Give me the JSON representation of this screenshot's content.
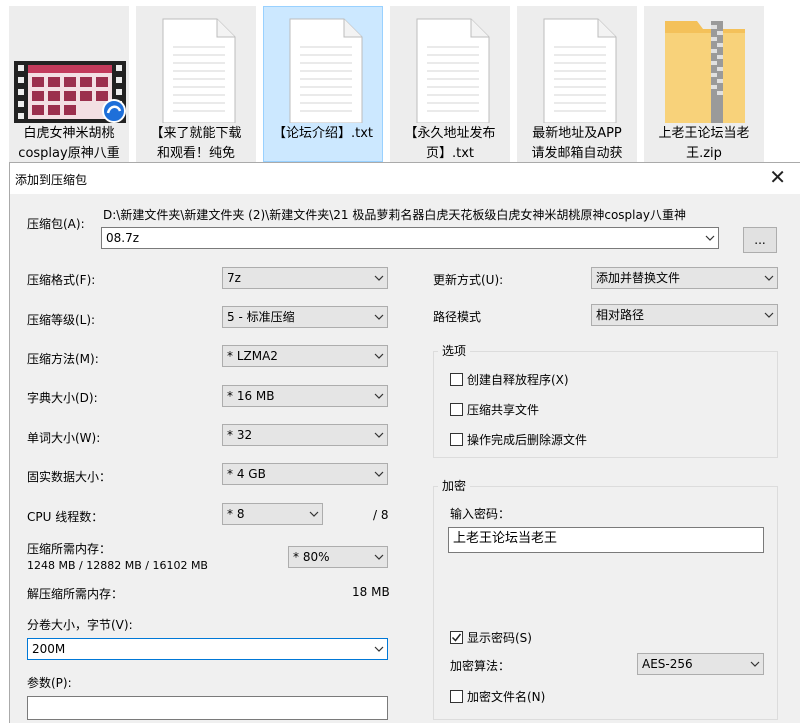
{
  "files": [
    {
      "name_line1": "白虎女神米胡桃",
      "name_line2": "cosplay原神八重",
      "type": "video"
    },
    {
      "name_line1": "【来了就能下载",
      "name_line2": "和观看！纯免",
      "type": "text"
    },
    {
      "name_line1": "【论坛介绍】.txt",
      "name_line2": "",
      "type": "text",
      "selected": true
    },
    {
      "name_line1": "【永久地址发布",
      "name_line2": "页】.txt",
      "type": "text"
    },
    {
      "name_line1": "最新地址及APP",
      "name_line2": "请发邮箱自动获",
      "type": "text"
    },
    {
      "name_line1": "上老王论坛当老",
      "name_line2": "王.zip",
      "type": "zip"
    }
  ],
  "dialog": {
    "title": "添加到压缩包",
    "close_glyph": "✕",
    "archive_label": "压缩包(A):",
    "archive_path_line1": "D:\\新建文件夹\\新建文件夹 (2)\\新建文件夹\\21 极品萝莉名器白虎天花板级白虎女神米胡桃原神cosplay八重神",
    "archive_path_line2": "08.7z",
    "browse_label": "...",
    "left": {
      "format_label": "压缩格式(F):",
      "format_value": "7z",
      "level_label": "压缩等级(L):",
      "level_value": "5 - 标准压缩",
      "method_label": "压缩方法(M):",
      "method_value": "* LZMA2",
      "dict_label": "字典大小(D):",
      "dict_value": "* 16 MB",
      "word_label": "单词大小(W):",
      "word_value": "* 32",
      "solid_label": "固实数据大小：",
      "solid_value": "* 4 GB",
      "cpu_label": "CPU 线程数：",
      "cpu_value": "* 8",
      "cpu_max": "/ 8",
      "mem_label": "压缩所需内存：",
      "mem_detail": "1248 MB / 12882 MB / 16102 MB",
      "mem_value": "* 80%",
      "decomp_label": "解压缩所需内存：",
      "decomp_value": "18 MB",
      "split_label": "分卷大小，字节(V):",
      "split_value": "200M",
      "params_label": "参数(P):",
      "params_value": ""
    },
    "right": {
      "update_label": "更新方式(U):",
      "update_value": "添加并替换文件",
      "path_label": "路径模式",
      "path_value": "相对路径",
      "options_title": "选项",
      "opt_sfx": "创建自释放程序(X)",
      "opt_sfx_checked": false,
      "opt_shared": "压缩共享文件",
      "opt_shared_checked": false,
      "opt_delete": "操作完成后删除源文件",
      "opt_delete_checked": false,
      "encrypt_title": "加密",
      "password_label": "输入密码：",
      "password_value": "上老王论坛当老王",
      "show_pw_label": "显示密码(S)",
      "show_pw_checked": true,
      "enc_method_label": "加密算法：",
      "enc_method_value": "AES-256",
      "enc_names_label": "加密文件名(N)",
      "enc_names_checked": false
    }
  }
}
